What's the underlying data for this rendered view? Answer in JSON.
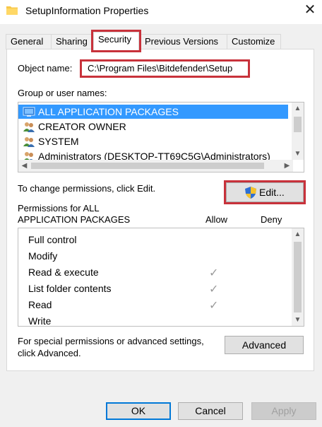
{
  "window": {
    "title": "SetupInformation Properties",
    "close_label": "✕"
  },
  "tabs": [
    {
      "label": "General"
    },
    {
      "label": "Sharing"
    },
    {
      "label": "Security"
    },
    {
      "label": "Previous Versions"
    },
    {
      "label": "Customize"
    }
  ],
  "object": {
    "label": "Object name:",
    "value": "C:\\Program Files\\Bitdefender\\Setup"
  },
  "groups": {
    "label": "Group or user names:",
    "items": [
      {
        "name": "ALL APPLICATION PACKAGES",
        "icon": "app-packages-icon",
        "selected": true
      },
      {
        "name": "CREATOR OWNER",
        "icon": "users-icon"
      },
      {
        "name": "SYSTEM",
        "icon": "users-icon"
      },
      {
        "name": "Administrators (DESKTOP-TT69C5G\\Administrators)",
        "icon": "users-icon"
      }
    ]
  },
  "change": {
    "text": "To change permissions, click Edit.",
    "edit_label": "Edit..."
  },
  "permissions": {
    "header": "Permissions for ALL\nAPPLICATION PACKAGES",
    "allow_label": "Allow",
    "deny_label": "Deny",
    "items": [
      {
        "name": "Full control",
        "allow": false
      },
      {
        "name": "Modify",
        "allow": false
      },
      {
        "name": "Read & execute",
        "allow": true
      },
      {
        "name": "List folder contents",
        "allow": true
      },
      {
        "name": "Read",
        "allow": true
      },
      {
        "name": "Write",
        "allow": false
      }
    ],
    "check_glyph": "✓"
  },
  "advanced": {
    "text": "For special permissions or advanced settings,\nclick Advanced.",
    "button_label": "Advanced"
  },
  "footer": {
    "ok_label": "OK",
    "cancel_label": "Cancel",
    "apply_label": "Apply"
  },
  "colors": {
    "highlight": "#c8323b",
    "selection": "#3399ff",
    "apply_disabled": "#a0a0a0"
  }
}
